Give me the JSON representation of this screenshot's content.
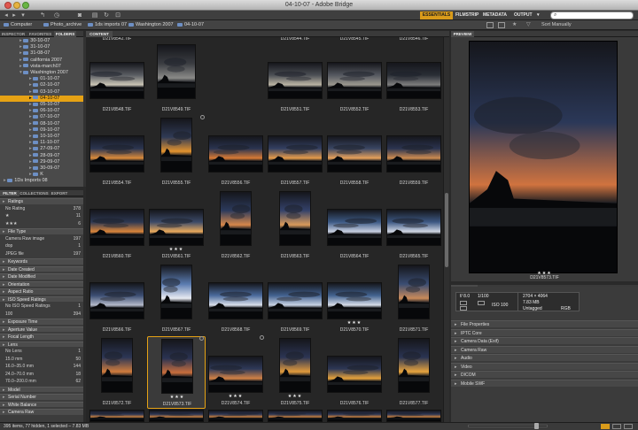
{
  "window": {
    "title": "04-10-07 - Adobe Bridge"
  },
  "toolbar": {
    "workspaces": [
      "ESSENTIALS",
      "FILMSTRIP",
      "METADATA",
      "OUTPUT"
    ],
    "output_arrow": "▾",
    "search_glyph": "⌕"
  },
  "path": {
    "crumbs": [
      "Computer",
      "Photo_archive",
      "1ds imports 07",
      "Washington 2007",
      "04-10-07"
    ],
    "sort_label": "Sort Manually"
  },
  "left_tabs": [
    "INSPECTOR",
    "FAVORITES",
    "FOLDERS"
  ],
  "folders": [
    {
      "label": "30-10-07",
      "level": 2
    },
    {
      "label": "31-10-07",
      "level": 2
    },
    {
      "label": "31-08-07",
      "level": 2
    },
    {
      "label": "california 2007",
      "level": 2
    },
    {
      "label": "vista-march07",
      "level": 2
    },
    {
      "label": "Washington 2007",
      "level": 2
    },
    {
      "label": "01-10-07",
      "level": 3
    },
    {
      "label": "02-10-07",
      "level": 3
    },
    {
      "label": "03-10-07",
      "level": 3
    },
    {
      "label": "04-10-07",
      "level": 3,
      "selected": true
    },
    {
      "label": "05-10-07",
      "level": 3
    },
    {
      "label": "06-10-07",
      "level": 3
    },
    {
      "label": "07-10-07",
      "level": 3
    },
    {
      "label": "08-10-07",
      "level": 3
    },
    {
      "label": "09-10-07",
      "level": 3
    },
    {
      "label": "10-10-07",
      "level": 3
    },
    {
      "label": "11-10-07",
      "level": 3
    },
    {
      "label": "27-09-07",
      "level": 3
    },
    {
      "label": "28-09-07",
      "level": 3
    },
    {
      "label": "29-09-07",
      "level": 3
    },
    {
      "label": "30-09-07",
      "level": 3
    },
    {
      "label": "K",
      "level": 3
    },
    {
      "label": "1Ds Imports 08",
      "level": 1
    }
  ],
  "filter_tabs": [
    "FILTER",
    "COLLECTIONS",
    "EXPORT"
  ],
  "filters": [
    {
      "label": "Ratings",
      "header": true
    },
    {
      "label": "No Rating",
      "count": "378"
    },
    {
      "label": "★",
      "count": "11"
    },
    {
      "label": "★★★",
      "count": "6"
    },
    {
      "label": "File Type",
      "header": true
    },
    {
      "label": "Camera Raw image",
      "count": "197"
    },
    {
      "label": "dop",
      "count": "1"
    },
    {
      "label": "JPEG file",
      "count": "197"
    },
    {
      "label": "Keywords",
      "header": true
    },
    {
      "label": "Date Created",
      "header": true
    },
    {
      "label": "Date Modified",
      "header": true
    },
    {
      "label": "Orientation",
      "header": true
    },
    {
      "label": "Aspect Ratio",
      "header": true
    },
    {
      "label": "ISO Speed Ratings",
      "header": true
    },
    {
      "label": "No ISO Speed Ratings",
      "count": "1"
    },
    {
      "label": "100",
      "count": "394"
    },
    {
      "label": "Exposure Time",
      "header": true
    },
    {
      "label": "Aperture Value",
      "header": true
    },
    {
      "label": "Focal Length",
      "header": true
    },
    {
      "label": "Lens",
      "header": true
    },
    {
      "label": "No Lens",
      "count": "1"
    },
    {
      "label": "15.0 mm",
      "count": "50"
    },
    {
      "label": "16.0–35.0 mm",
      "count": "144"
    },
    {
      "label": "24.0–70.0 mm",
      "count": "18"
    },
    {
      "label": "70.0–200.0 mm",
      "count": "62"
    },
    {
      "label": "Model",
      "header": true
    },
    {
      "label": "Serial Number",
      "header": true
    },
    {
      "label": "White Balance",
      "header": true
    },
    {
      "label": "Camera Raw",
      "header": true
    }
  ],
  "content": {
    "tab": "CONTENT",
    "top_captions": [
      "D21V8542.TIF",
      "",
      "",
      "D21V8544.TIF",
      "D21V8545.TIF",
      "D21V8546.TIF"
    ],
    "thumbnails": [
      {
        "caption": "D21V8548.TIF",
        "stars": "",
        "w": 62,
        "h": 42,
        "sky": "#5a5d63",
        "glow": "#c9c4b5",
        "orient": "land"
      },
      {
        "caption": "D21V8549.TIF",
        "stars": "",
        "w": 44,
        "h": 62,
        "sky": "#3b3d42",
        "glow": "#8a8a88",
        "orient": "port"
      },
      {
        "caption": "",
        "stars": "",
        "w": 0,
        "h": 0,
        "sky": "",
        "glow": "",
        "orient": "none"
      },
      {
        "caption": "D21V8551.TIF",
        "stars": "",
        "w": 62,
        "h": 42,
        "sky": "#4c4f55",
        "glow": "#b9b3a3",
        "orient": "land"
      },
      {
        "caption": "D21V8552.TIF",
        "stars": "",
        "w": 62,
        "h": 42,
        "sky": "#555860",
        "glow": "#9a978e",
        "orient": "land"
      },
      {
        "caption": "D21V8553.TIF",
        "stars": "",
        "w": 62,
        "h": 42,
        "sky": "#2a2e36",
        "glow": "#7d7d7d",
        "orient": "land"
      },
      {
        "caption": "D21V8554.TIF",
        "stars": "",
        "w": 62,
        "h": 42,
        "sky": "#2b3550",
        "glow": "#d98a3a",
        "orient": "land"
      },
      {
        "caption": "D21V8555.TIF",
        "stars": "",
        "w": 36,
        "h": 62,
        "sky": "#2f3a55",
        "glow": "#e3932e",
        "orient": "port",
        "rotate": true
      },
      {
        "caption": "D21V8556.TIF",
        "stars": "",
        "w": 62,
        "h": 42,
        "sky": "#2a3450",
        "glow": "#d77a34",
        "orient": "land"
      },
      {
        "caption": "D21V8557.TIF",
        "stars": "",
        "w": 62,
        "h": 42,
        "sky": "#334061",
        "glow": "#e49a4a",
        "orient": "land"
      },
      {
        "caption": "D21V8558.TIF",
        "stars": "",
        "w": 62,
        "h": 42,
        "sky": "#3a4663",
        "glow": "#e6a05a",
        "orient": "land"
      },
      {
        "caption": "D21V8559.TIF",
        "stars": "",
        "w": 62,
        "h": 42,
        "sky": "#2b3450",
        "glow": "#cc8b50",
        "orient": "land"
      },
      {
        "caption": "D21V8560.TIF",
        "stars": "",
        "w": 62,
        "h": 42,
        "sky": "#2d3852",
        "glow": "#d9843a",
        "orient": "land"
      },
      {
        "caption": "D21V8561.TIF",
        "stars": "★★★",
        "w": 62,
        "h": 42,
        "sky": "#3c4a68",
        "glow": "#e9a95c",
        "orient": "land"
      },
      {
        "caption": "D21V8562.TIF",
        "stars": "",
        "w": 36,
        "h": 62,
        "sky": "#2c3a5c",
        "glow": "#d7874a",
        "orient": "port"
      },
      {
        "caption": "D21V8563.TIF",
        "stars": "",
        "w": 36,
        "h": 62,
        "sky": "#34426a",
        "glow": "#d99a5a",
        "orient": "port"
      },
      {
        "caption": "D21V8564.TIF",
        "stars": "",
        "w": 62,
        "h": 42,
        "sky": "#3d5a85",
        "glow": "#c7cfe0",
        "orient": "land"
      },
      {
        "caption": "D21V8565.TIF",
        "stars": "",
        "w": 62,
        "h": 42,
        "sky": "#3d5883",
        "glow": "#cfd6e3",
        "orient": "land"
      },
      {
        "caption": "D21V8566.TIF",
        "stars": "",
        "w": 62,
        "h": 42,
        "sky": "#3b4d72",
        "glow": "#b3b8c8",
        "orient": "land"
      },
      {
        "caption": "D21V8567.TIF",
        "stars": "",
        "w": 36,
        "h": 62,
        "sky": "#5a7bb0",
        "glow": "#e8ebf2",
        "orient": "port"
      },
      {
        "caption": "D21V8568.TIF",
        "stars": "",
        "w": 62,
        "h": 42,
        "sky": "#4a6a9c",
        "glow": "#d8dee9",
        "orient": "land"
      },
      {
        "caption": "D21V8569.TIF",
        "stars": "",
        "w": 62,
        "h": 42,
        "sky": "#42618f",
        "glow": "#c7d1e2",
        "orient": "land"
      },
      {
        "caption": "D21V8570.TIF",
        "stars": "★★★",
        "w": 62,
        "h": 42,
        "sky": "#42628f",
        "glow": "#d5dbe6",
        "orient": "land"
      },
      {
        "caption": "D21V8571.TIF",
        "stars": "",
        "w": 36,
        "h": 62,
        "sky": "#3a4d72",
        "glow": "#c98a5a",
        "orient": "port"
      },
      {
        "caption": "D21V8572.TIF",
        "stars": "",
        "w": 36,
        "h": 62,
        "sky": "#2c3655",
        "glow": "#d07c3d",
        "orient": "port"
      },
      {
        "caption": "D21V8573.TIF",
        "stars": "★★★",
        "w": 36,
        "h": 62,
        "sky": "#2a3352",
        "glow": "#c86e3c",
        "orient": "port",
        "selected": true,
        "rotate": true
      },
      {
        "caption": "D21V8574.TIF",
        "stars": "★★★",
        "w": 62,
        "h": 42,
        "sky": "#2e3958",
        "glow": "#d28245",
        "orient": "land",
        "rotate": true
      },
      {
        "caption": "D21V8575.TIF",
        "stars": "★★★",
        "w": 36,
        "h": 62,
        "sky": "#2c3554",
        "glow": "#e19a3c",
        "orient": "port"
      },
      {
        "caption": "D21V8576.TIF",
        "stars": "",
        "w": 62,
        "h": 42,
        "sky": "#2d3755",
        "glow": "#e5a23b",
        "orient": "land"
      },
      {
        "caption": "D21V8577.TIF",
        "stars": "",
        "w": 36,
        "h": 62,
        "sky": "#2a3452",
        "glow": "#e7a43e",
        "orient": "port"
      }
    ]
  },
  "preview": {
    "tab": "PREVIEW",
    "caption": "D21V8573.TIF",
    "stars": "★★★",
    "sky": "#2b3858",
    "glow": "#d0733f"
  },
  "metadata": {
    "tabs": [
      "METADATA",
      "KEYWORDS"
    ],
    "aperture": "f/ 8.0",
    "shutter": "1/100",
    "dims": "2704 × 4064",
    "size": "7.83 MB",
    "iso": "ISO 100",
    "label": "Untagged",
    "mode": "RGB",
    "sections": [
      "File Properties",
      "IPTC Core",
      "Camera Data (Exif)",
      "Camera Raw",
      "Audio",
      "Video",
      "DICOM",
      "Mobile SWF"
    ]
  },
  "status": {
    "text": "395 items, 77 hidden, 1 selected – 7.83 MB"
  },
  "colors": {
    "accent": "#e6a214",
    "panel": "#4a4a4a",
    "content": "#262626"
  }
}
